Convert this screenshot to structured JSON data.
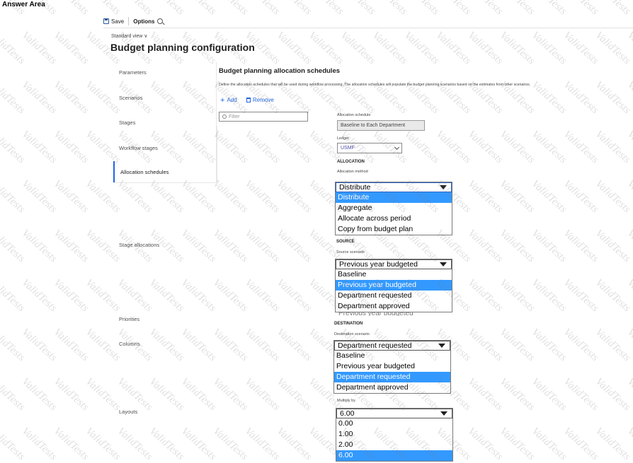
{
  "answer_area": "Answer Area",
  "toolbar": {
    "save_label": "Save",
    "options_label": "Options"
  },
  "view_selector": "Standard view ∨",
  "page_title": "Budget planning configuration",
  "nav": {
    "parameters": "Parameters",
    "scenarios": "Scenarios",
    "stages": "Stages",
    "workflow_stages": "Workflow stages",
    "allocation_schedules": "Allocation schedules",
    "stage_allocations": "Stage allocations",
    "priorities": "Priorities",
    "columns": "Columns",
    "layouts": "Layouts"
  },
  "section": {
    "title": "Budget planning allocation schedules",
    "description": "Define the allocation schedules that will be used during workflow processing. The allocation schedules will populate the budget planning scenarios based on the estimates from other scenarios.",
    "add_label": "Add",
    "remove_label": "Remove",
    "filter_placeholder": "Filter"
  },
  "form": {
    "allocation_schedule_label": "Allocation schedule",
    "allocation_schedule_value": "Baseline to Each Department",
    "ledger_label": "Ledger",
    "ledger_value": "USMF",
    "allocation_heading": "ALLOCATION",
    "allocation_method_label": "Allocation method",
    "source_heading": "SOURCE",
    "source_scenario_label": "Source scenario",
    "destination_heading": "DESTINATION",
    "destination_scenario_label": "Destination scenario",
    "multiply_by_label": "Multiply by",
    "ghost_text": "Previous year budgeted"
  },
  "dropdowns": {
    "allocation_method": {
      "selected": "Distribute",
      "options": [
        "Distribute",
        "Aggregate",
        "Allocate across period",
        "Copy from budget plan"
      ],
      "highlighted_index": 0
    },
    "source_scenario": {
      "selected": "Previous year budgeted",
      "options": [
        "Baseline",
        "Previous year budgeted",
        "Department requested",
        "Department approved"
      ],
      "highlighted_index": 1
    },
    "destination_scenario": {
      "selected": "Department requested",
      "options": [
        "Baseline",
        "Previous year budgeted",
        "Department requested",
        "Department approved"
      ],
      "highlighted_index": 2
    },
    "multiply_by": {
      "selected": "6.00",
      "options": [
        "0.00",
        "1.00",
        "2.00",
        "6.00"
      ],
      "highlighted_index": 3
    }
  },
  "watermark_text": "ValidTests",
  "colors": {
    "accent": "#2266e3",
    "highlight": "#3399ff"
  }
}
